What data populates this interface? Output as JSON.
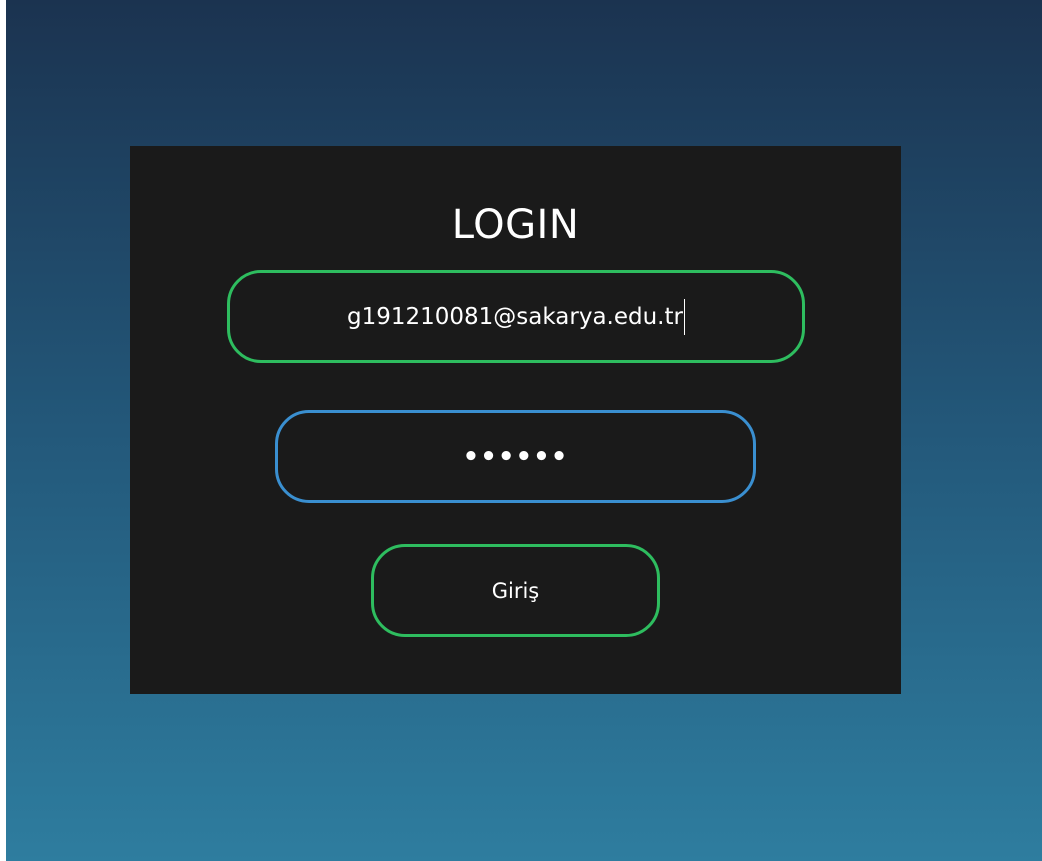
{
  "login": {
    "title": "LOGIN",
    "email_value": "g191210081@sakarya.edu.tr",
    "password_masked": "••••••",
    "submit_label": "Giriş"
  },
  "colors": {
    "panel_background": "#1a1a1a",
    "email_border": "#2ebd5f",
    "password_border": "#3a8fd0",
    "button_border": "#2ebd5f",
    "gradient_top": "#1b3350",
    "gradient_bottom": "#2e7d9f"
  }
}
